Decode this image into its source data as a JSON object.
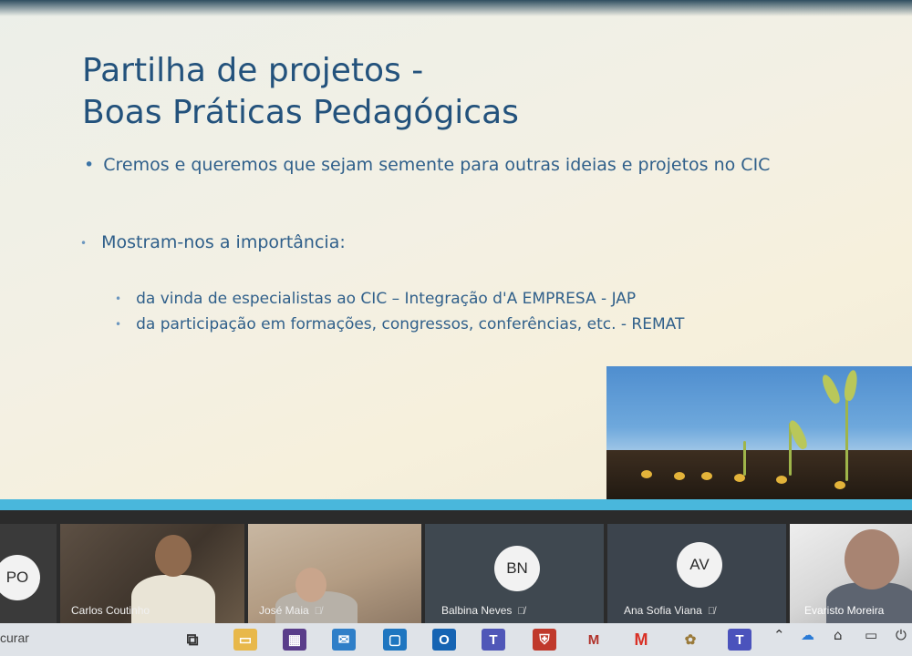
{
  "slide": {
    "title_line1": "Partilha de projetos -",
    "title_line2": "Boas Práticas Pedagógicas",
    "bullet1": "Cremos e queremos que sejam semente para outras ideias e projetos no CIC",
    "bullet2": "Mostram-nos a importância:",
    "sub_bullet1": "da vinda de especialistas ao CIC – Integração d'A EMPRESA - JAP",
    "sub_bullet2": "da participação em formações, congressos, conferências, etc. - REMAT"
  },
  "participants": [
    {
      "initials": "PO",
      "name": ""
    },
    {
      "initials": "",
      "name": "Carlos Coutinho"
    },
    {
      "initials": "",
      "name": "José Maia"
    },
    {
      "initials": "BN",
      "name": "Balbina Neves"
    },
    {
      "initials": "AV",
      "name": "Ana Sofia Viana"
    },
    {
      "initials": "",
      "name": "Evaristo Moreira"
    }
  ],
  "taskbar": {
    "search_text": "curar"
  },
  "colors": {
    "title": "#23527c",
    "bullet_text": "#2f5f8a",
    "slide_band": "#49b7dc",
    "tile_bg": "#3f4850",
    "taskbar_bg": "#dfe3e8"
  }
}
